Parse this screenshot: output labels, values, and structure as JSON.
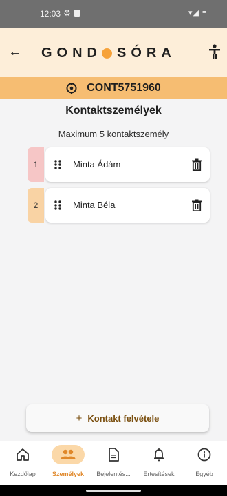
{
  "status_bar": {
    "time": "12:03",
    "indicators": "▾◢ ≡"
  },
  "header": {
    "logo_left": "GOND",
    "logo_right": "SÓRA",
    "back_icon": "arrow-left-icon",
    "accessibility_icon": "accessibility-icon"
  },
  "device": {
    "code": "CONT5751960",
    "icon": "device-target-icon"
  },
  "page": {
    "title": "Kontaktszemélyek",
    "subtitle": "Maximum 5 kontaktszemély"
  },
  "contacts": [
    {
      "index": "1",
      "name": "Minta Ádám",
      "index_color": "#f6c6c6"
    },
    {
      "index": "2",
      "name": "Minta Béla",
      "index_color": "#f9d3a4"
    }
  ],
  "add_button": {
    "plus": "+",
    "label": "Kontakt felvétele"
  },
  "nav": [
    {
      "label": "Kezdőlap",
      "icon": "home-icon",
      "active": false
    },
    {
      "label": "Személyek",
      "icon": "people-icon",
      "active": true
    },
    {
      "label": "Bejelentés...",
      "icon": "document-icon",
      "active": false
    },
    {
      "label": "Értesítések",
      "icon": "bell-icon",
      "active": false
    },
    {
      "label": "Egyéb",
      "icon": "info-icon",
      "active": false
    }
  ],
  "colors": {
    "accent": "#f6a23a",
    "header_bg": "#fdeed9",
    "device_bar": "#f6bd72",
    "active_label": "#e0882a"
  }
}
